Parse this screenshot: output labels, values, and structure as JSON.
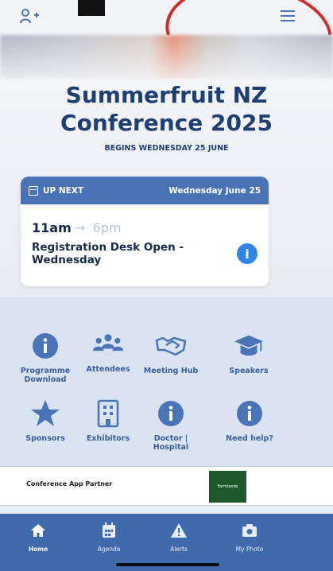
{
  "header": {
    "left_icon": "add-person-icon",
    "menu_icon": "hamburger-menu-icon"
  },
  "hero": {
    "title_line1": "Summerfruit NZ",
    "title_line2": "Conference 2025",
    "begins": "BEGINS WEDNESDAY 25 JUNE"
  },
  "up_next": {
    "label": "UP NEXT",
    "date": "Wednesday June 25",
    "start_time": "11am",
    "end_time": "6pm",
    "event_title": "Registration Desk Open - Wednesday",
    "info_icon_text": "i"
  },
  "tiles": [
    {
      "label": "Programme Download",
      "icon": "info-icon"
    },
    {
      "label": "Attendees",
      "icon": "people-icon"
    },
    {
      "label": "Meeting Hub",
      "icon": "handshake-icon"
    },
    {
      "label": "Speakers",
      "icon": "graduation-cap-icon"
    },
    {
      "label": "Sponsors",
      "icon": "star-icon"
    },
    {
      "label": "Exhibitors",
      "icon": "building-icon"
    },
    {
      "label": "Doctor | Hospital",
      "icon": "info-icon"
    },
    {
      "label": "Need help?",
      "icon": "info-icon"
    }
  ],
  "partner": {
    "text": "Conference App Partner",
    "logo_text": "Farmlands"
  },
  "nav": [
    {
      "label": "Home",
      "icon": "home-icon"
    },
    {
      "label": "Agenda",
      "icon": "calendar-icon"
    },
    {
      "label": "Alerts",
      "icon": "alert-icon"
    },
    {
      "label": "My Photo",
      "icon": "camera-icon"
    }
  ],
  "colors": {
    "primary": "#4a72b6",
    "title": "#1f3f73",
    "nav_bg": "#3f6aae",
    "annotation": "#d42a2a"
  }
}
